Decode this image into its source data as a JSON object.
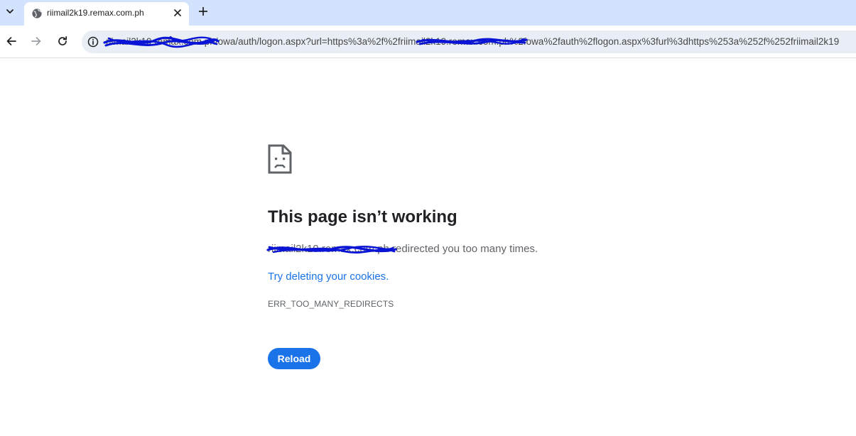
{
  "tab": {
    "title": "riimail2k19.remax.com.ph",
    "favicon": "globe-icon"
  },
  "toolbar": {
    "url_prefix": "riimail2k19.remax.com.ph",
    "url_visible_path": "/owa/auth/logon.aspx?url=https%3a%2f%2friimail2k19.remax.com.ph%2fowa%2fauth%2flogon.aspx%3furl%3dhttps%253a%252f%252friimail2k19"
  },
  "error": {
    "icon": "sad-page-icon",
    "heading": "This page isn’t working",
    "host": "riimail2k19.remax.com.ph",
    "detail_suffix": " redirected you too many times.",
    "link_text": "Try deleting your cookies",
    "link_period": ".",
    "code": "ERR_TOO_MANY_REDIRECTS",
    "button_label": "Reload"
  },
  "colors": {
    "tabstrip": "#d3e3fd",
    "omnibox": "#e9eef6",
    "accent": "#1a73e8",
    "redaction_ink": "#0a14d6"
  }
}
